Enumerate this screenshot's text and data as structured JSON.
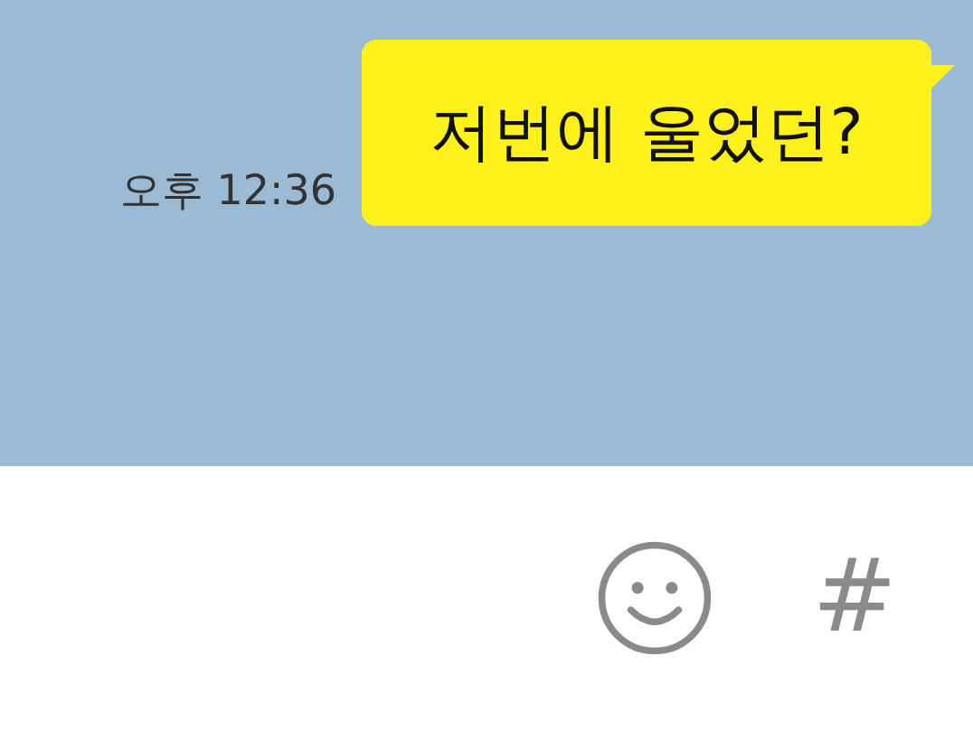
{
  "messages": [
    {
      "time": "오후 12:36",
      "text": "저번에 울었던?"
    }
  ],
  "input_bar": {
    "hash_button": "#"
  }
}
